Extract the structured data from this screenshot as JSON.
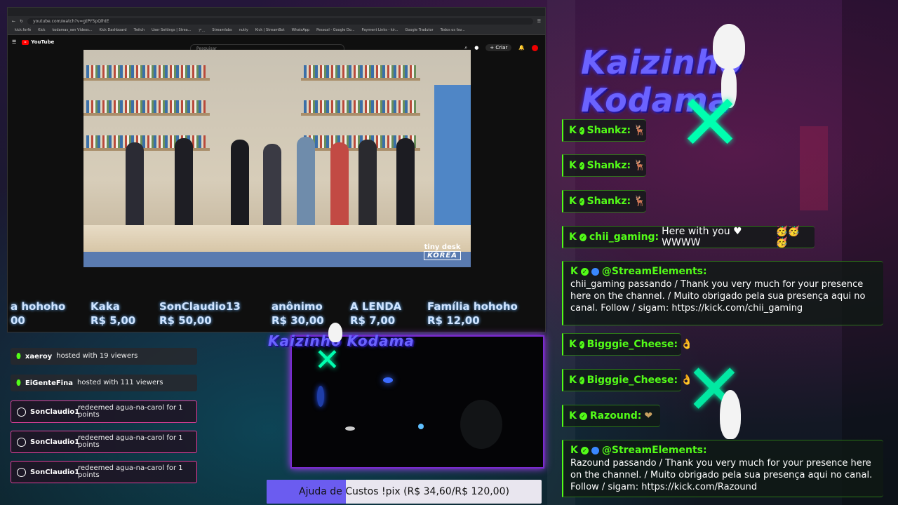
{
  "browser": {
    "url": "youtube.com/watch?v=gtPY5pQlhtE",
    "bookmarks": [
      "kick.forfé",
      "Kick",
      "kodamas_sen Vídeos...",
      "Kick Dashboard",
      "Twitch",
      "User Settings | Strea...",
      "ア...",
      "Streamlabs",
      "nutty",
      "Kick | StreamBot",
      "WhatsApp",
      "Pessoal - Google Do...",
      "Payment Links - kir...",
      "Google Tradutor",
      "Todos os fav..."
    ]
  },
  "youtube": {
    "logo": "YouTube",
    "search_placeholder": "Pesquisar",
    "create_label": "Criar"
  },
  "video": {
    "brand_line1": "tiny desk",
    "brand_line2": "KOREA"
  },
  "donations": [
    {
      "name": "a hohoho",
      "amount": "00"
    },
    {
      "name": "Kaka",
      "amount": "R$ 5,00"
    },
    {
      "name": "SonClaudio13",
      "amount": "R$ 50,00"
    },
    {
      "name": "anônimo",
      "amount": "R$ 30,00"
    },
    {
      "name": "A LENDA",
      "amount": "R$ 7,00"
    },
    {
      "name": "Família hohoho",
      "amount": "R$ 12,00"
    }
  ],
  "alerts": {
    "hosts": [
      {
        "user": "xaeroy",
        "text": "hosted with 19 viewers"
      },
      {
        "user": "EiGenteFina",
        "text": "hosted with 111 viewers"
      }
    ],
    "redeems": [
      {
        "user": "SonClaudio1",
        "text": "redeemed agua-na-carol for 1 points"
      },
      {
        "user": "SonClaudio1",
        "text": "redeemed agua-na-carol for 1 points"
      },
      {
        "user": "SonClaudio1",
        "text": "redeemed agua-na-carol for 1 points"
      }
    ]
  },
  "logo": {
    "text": "Kaizinho Kodama"
  },
  "chat": {
    "messages": [
      {
        "user": "Shankz:",
        "text": "",
        "emote": "🦌"
      },
      {
        "user": "Shankz:",
        "text": "",
        "emote": "🦌"
      },
      {
        "user": "Shankz:",
        "text": "",
        "emote": "🦌"
      },
      {
        "user": "chii_gaming:",
        "text": "Here with you ♥ WWWW",
        "emote": "🥳🥳🥳"
      },
      {
        "user": "Bigggie_Cheese:",
        "text": "",
        "emote": "👌"
      },
      {
        "user": "Bigggie_Cheese:",
        "text": "",
        "emote": "👌"
      },
      {
        "user": "Razound:",
        "text": "",
        "emote": "❤"
      }
    ],
    "bot_messages": [
      {
        "user": "@StreamElements:",
        "text": "chii_gaming passando / Thank you very much for your presence here on the channel. / Muito obrigado pela sua presença aqui no canal. Follow / sigam: https://kick.com/chii_gaming"
      },
      {
        "user": "@StreamElements:",
        "text": "Razound passando / Thank you very much for your presence here on the channel. / Muito obrigado pela sua presença aqui no canal. Follow / sigam: https://kick.com/Razound"
      }
    ]
  },
  "goal": {
    "label": "Ajuda de Custos !pix (R$ 34,60/R$ 120,00)",
    "current": 34.6,
    "target": 120.0
  },
  "colors": {
    "kick_green": "#53fc18",
    "accent_purple": "#7a2ad0",
    "goal_fill": "#6b5cf0"
  }
}
